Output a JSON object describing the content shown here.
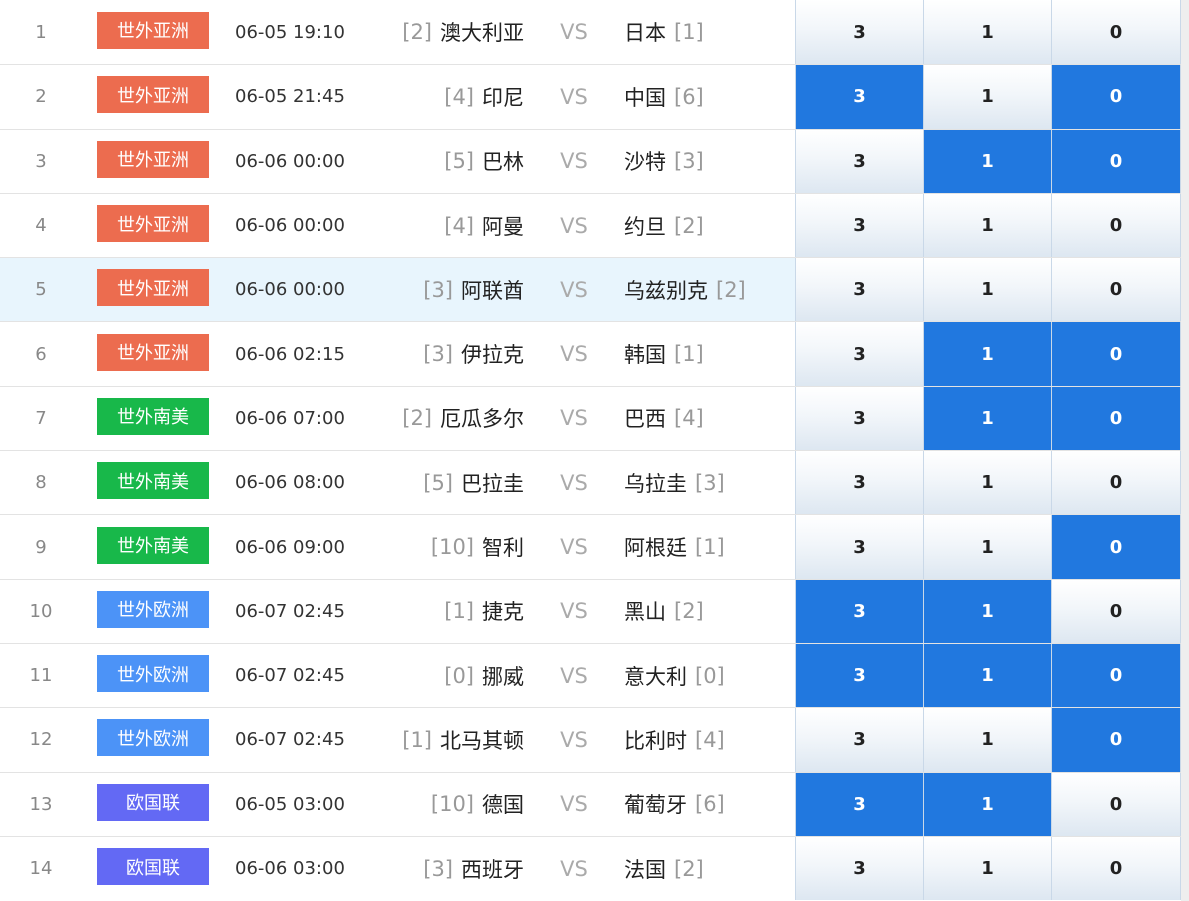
{
  "colors": {
    "asia": "#ec6c4f",
    "south_america": "#18b84a",
    "europe": "#4c93f7",
    "nations_league": "#6369f4",
    "selected": "#2178df"
  },
  "matches": [
    {
      "no": "1",
      "league": "世外亚洲",
      "league_key": "asia",
      "time": "06-05 19:10",
      "home_rank": "[2]",
      "home": "澳大利亚",
      "vs": "VS",
      "away": "日本",
      "away_rank": "[1]",
      "odds": [
        "3",
        "1",
        "0"
      ],
      "selected": [
        false,
        false,
        false
      ]
    },
    {
      "no": "2",
      "league": "世外亚洲",
      "league_key": "asia",
      "time": "06-05 21:45",
      "home_rank": "[4]",
      "home": "印尼",
      "vs": "VS",
      "away": "中国",
      "away_rank": "[6]",
      "odds": [
        "3",
        "1",
        "0"
      ],
      "selected": [
        true,
        false,
        true
      ]
    },
    {
      "no": "3",
      "league": "世外亚洲",
      "league_key": "asia",
      "time": "06-06 00:00",
      "home_rank": "[5]",
      "home": "巴林",
      "vs": "VS",
      "away": "沙特",
      "away_rank": "[3]",
      "odds": [
        "3",
        "1",
        "0"
      ],
      "selected": [
        false,
        true,
        true
      ]
    },
    {
      "no": "4",
      "league": "世外亚洲",
      "league_key": "asia",
      "time": "06-06 00:00",
      "home_rank": "[4]",
      "home": "阿曼",
      "vs": "VS",
      "away": "约旦",
      "away_rank": "[2]",
      "odds": [
        "3",
        "1",
        "0"
      ],
      "selected": [
        false,
        false,
        false
      ]
    },
    {
      "no": "5",
      "league": "世外亚洲",
      "league_key": "asia",
      "time": "06-06 00:00",
      "home_rank": "[3]",
      "home": "阿联酋",
      "vs": "VS",
      "away": "乌兹别克",
      "away_rank": "[2]",
      "odds": [
        "3",
        "1",
        "0"
      ],
      "selected": [
        false,
        false,
        false
      ],
      "highlight": true
    },
    {
      "no": "6",
      "league": "世外亚洲",
      "league_key": "asia",
      "time": "06-06 02:15",
      "home_rank": "[3]",
      "home": "伊拉克",
      "vs": "VS",
      "away": "韩国",
      "away_rank": "[1]",
      "odds": [
        "3",
        "1",
        "0"
      ],
      "selected": [
        false,
        true,
        true
      ]
    },
    {
      "no": "7",
      "league": "世外南美",
      "league_key": "south_america",
      "time": "06-06 07:00",
      "home_rank": "[2]",
      "home": "厄瓜多尔",
      "vs": "VS",
      "away": "巴西",
      "away_rank": "[4]",
      "odds": [
        "3",
        "1",
        "0"
      ],
      "selected": [
        false,
        true,
        true
      ]
    },
    {
      "no": "8",
      "league": "世外南美",
      "league_key": "south_america",
      "time": "06-06 08:00",
      "home_rank": "[5]",
      "home": "巴拉圭",
      "vs": "VS",
      "away": "乌拉圭",
      "away_rank": "[3]",
      "odds": [
        "3",
        "1",
        "0"
      ],
      "selected": [
        false,
        false,
        false
      ]
    },
    {
      "no": "9",
      "league": "世外南美",
      "league_key": "south_america",
      "time": "06-06 09:00",
      "home_rank": "[10]",
      "home": "智利",
      "vs": "VS",
      "away": "阿根廷",
      "away_rank": "[1]",
      "odds": [
        "3",
        "1",
        "0"
      ],
      "selected": [
        false,
        false,
        true
      ]
    },
    {
      "no": "10",
      "league": "世外欧洲",
      "league_key": "europe",
      "time": "06-07 02:45",
      "home_rank": "[1]",
      "home": "捷克",
      "vs": "VS",
      "away": "黑山",
      "away_rank": "[2]",
      "odds": [
        "3",
        "1",
        "0"
      ],
      "selected": [
        true,
        true,
        false
      ]
    },
    {
      "no": "11",
      "league": "世外欧洲",
      "league_key": "europe",
      "time": "06-07 02:45",
      "home_rank": "[0]",
      "home": "挪威",
      "vs": "VS",
      "away": "意大利",
      "away_rank": "[0]",
      "odds": [
        "3",
        "1",
        "0"
      ],
      "selected": [
        true,
        true,
        true
      ]
    },
    {
      "no": "12",
      "league": "世外欧洲",
      "league_key": "europe",
      "time": "06-07 02:45",
      "home_rank": "[1]",
      "home": "北马其顿",
      "vs": "VS",
      "away": "比利时",
      "away_rank": "[4]",
      "odds": [
        "3",
        "1",
        "0"
      ],
      "selected": [
        false,
        false,
        true
      ]
    },
    {
      "no": "13",
      "league": "欧国联",
      "league_key": "nations_league",
      "time": "06-05 03:00",
      "home_rank": "[10]",
      "home": "德国",
      "vs": "VS",
      "away": "葡萄牙",
      "away_rank": "[6]",
      "odds": [
        "3",
        "1",
        "0"
      ],
      "selected": [
        true,
        true,
        false
      ]
    },
    {
      "no": "14",
      "league": "欧国联",
      "league_key": "nations_league",
      "time": "06-06 03:00",
      "home_rank": "[3]",
      "home": "西班牙",
      "vs": "VS",
      "away": "法国",
      "away_rank": "[2]",
      "odds": [
        "3",
        "1",
        "0"
      ],
      "selected": [
        false,
        false,
        false
      ]
    }
  ]
}
